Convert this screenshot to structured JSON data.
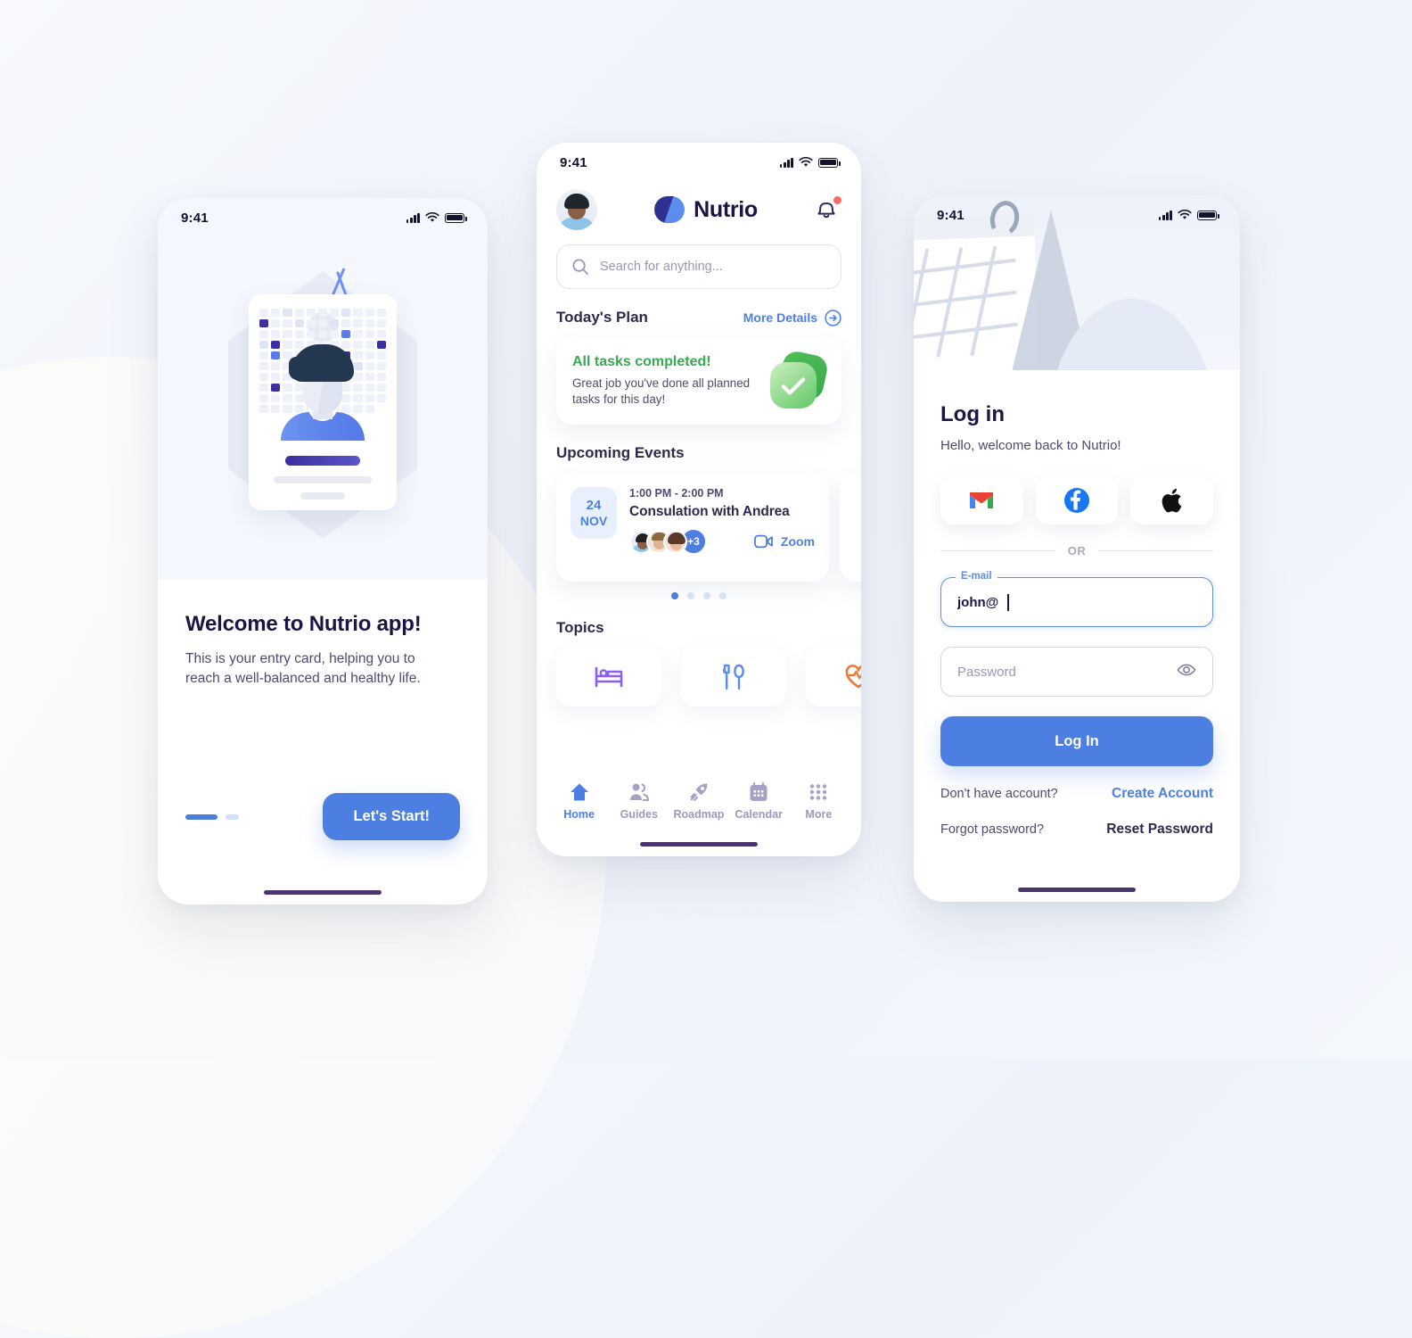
{
  "brand": {
    "name": "Nutrio",
    "accent": "#4d7fe3",
    "ink": "#1b1546",
    "green": "#39a851",
    "alert": "#fc6a66"
  },
  "screen_onboarding": {
    "status": {
      "time": "9:41",
      "signal_icon": "signal-bars-icon",
      "wifi_icon": "wifi-icon",
      "battery_icon": "battery-icon"
    },
    "illustration_name": "entry-card-illustration",
    "title": "Welcome to Nutrio app!",
    "subtitle": "This is your entry card, helping you to reach a well-balanced and healthy life.",
    "pagination": {
      "total": 2,
      "active": 1
    },
    "cta_label": "Let's Start!"
  },
  "screen_home": {
    "status": {
      "time": "9:41"
    },
    "header": {
      "avatar_name": "user-avatar",
      "logo_text": "Nutrio",
      "bell_icon": "bell-icon",
      "has_notification": true
    },
    "search": {
      "placeholder": "Search for anything...",
      "value": "",
      "icon": "search-icon"
    },
    "todays_plan": {
      "section_title": "Today's Plan",
      "more_label": "More Details",
      "more_icon": "arrow-right-circle-icon",
      "card": {
        "heading": "All tasks completed!",
        "body": "Great job you've done all planned tasks for this day!",
        "badge_icon": "check-shield-icon"
      }
    },
    "upcoming_events": {
      "section_title": "Upcoming Events",
      "events": [
        {
          "day": "24",
          "month": "NOV",
          "time": "1:00 PM - 2:00 PM",
          "title": "Consulation with Andrea",
          "extra_attendees": "+3",
          "action_label": "Zoom",
          "action_icon": "video-camera-icon"
        }
      ],
      "carousel": {
        "total": 4,
        "active": 1
      }
    },
    "topics": {
      "section_title": "Topics",
      "items": [
        {
          "icon": "bed-icon",
          "color": "#8b5cf6"
        },
        {
          "icon": "fork-spoon-icon",
          "color": "#5b8def"
        },
        {
          "icon": "heart-pulse-icon",
          "color": "#f2772f"
        }
      ]
    },
    "tabbar": [
      {
        "label": "Home",
        "icon": "home-icon",
        "active": true
      },
      {
        "label": "Guides",
        "icon": "people-icon",
        "active": false
      },
      {
        "label": "Roadmap",
        "icon": "rocket-icon",
        "active": false
      },
      {
        "label": "Calendar",
        "icon": "calendar-icon",
        "active": false
      },
      {
        "label": "More",
        "icon": "grid-dots-icon",
        "active": false
      }
    ]
  },
  "screen_login": {
    "status": {
      "time": "9:41"
    },
    "illustration_name": "calendar-illustration",
    "title": "Log in",
    "subtitle": "Hello, welcome back to Nutrio!",
    "social": [
      {
        "name": "google-gmail-icon"
      },
      {
        "name": "facebook-icon"
      },
      {
        "name": "apple-icon"
      }
    ],
    "divider_label": "OR",
    "email_field": {
      "label": "E-mail",
      "value": "john@",
      "placeholder": "E-mail"
    },
    "password_field": {
      "placeholder": "Password",
      "value": "",
      "toggle_icon": "eye-icon"
    },
    "submit_label": "Log In",
    "links": [
      {
        "question": "Don't have account?",
        "action": "Create Account",
        "style": "accent"
      },
      {
        "question": "Forgot password?",
        "action": "Reset Password",
        "style": "dark"
      }
    ]
  }
}
